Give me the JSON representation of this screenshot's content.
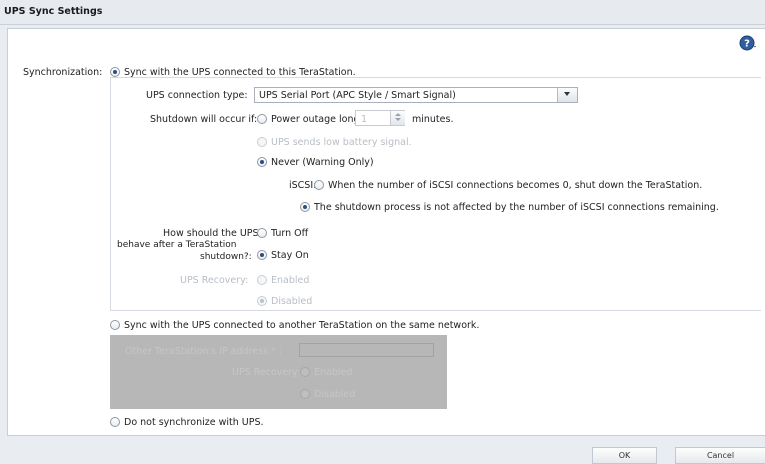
{
  "window": {
    "title": "UPS Sync Settings"
  },
  "form": {
    "synchronization_label": "Synchronization:",
    "sync_local_option": "Sync with the UPS connected to this TeraStation.",
    "connection_type_label": "UPS connection type:",
    "connection_type_value": "UPS Serial Port (APC Style / Smart Signal)",
    "shutdown_label": "Shutdown will occur if:",
    "power_outage_option": "Power outage longer than",
    "minutes_value": "1",
    "minutes_label": "minutes.",
    "low_battery_option": "UPS sends low battery signal.",
    "never_option": "Never (Warning Only)",
    "iscsi_label": "iSCSI:",
    "iscsi_option_1": "When the number of iSCSI connections becomes 0, shut down the TeraStation.",
    "iscsi_option_2": "The shutdown process is not affected by the number of iSCSI connections remaining.",
    "behave_label_1": "How should the UPS",
    "behave_label_2": "behave after a TeraStation",
    "behave_label_3": "shutdown?:",
    "turn_off_option": "Turn Off",
    "stay_on_option": "Stay On",
    "ups_recovery_label": "UPS Recovery:",
    "enabled_option": "Enabled",
    "disabled_option": "Disabled",
    "sync_remote_option": "Sync with the UPS connected to another TeraStation on the same network.",
    "other_ip_label": "Other TeraStation's IP address * :",
    "other_recovery_label": "UPS Recovery:",
    "other_enabled_option": "Enabled",
    "other_disabled_option": "Disabled",
    "no_sync_option": "Do not synchronize with UPS."
  },
  "buttons": {
    "ok": "OK",
    "cancel": "Cancel"
  },
  "colors": {
    "panel_bg": "#ffffff",
    "dialog_bg": "#e9edf2",
    "disabled_overlay": "#b7b7b7"
  }
}
